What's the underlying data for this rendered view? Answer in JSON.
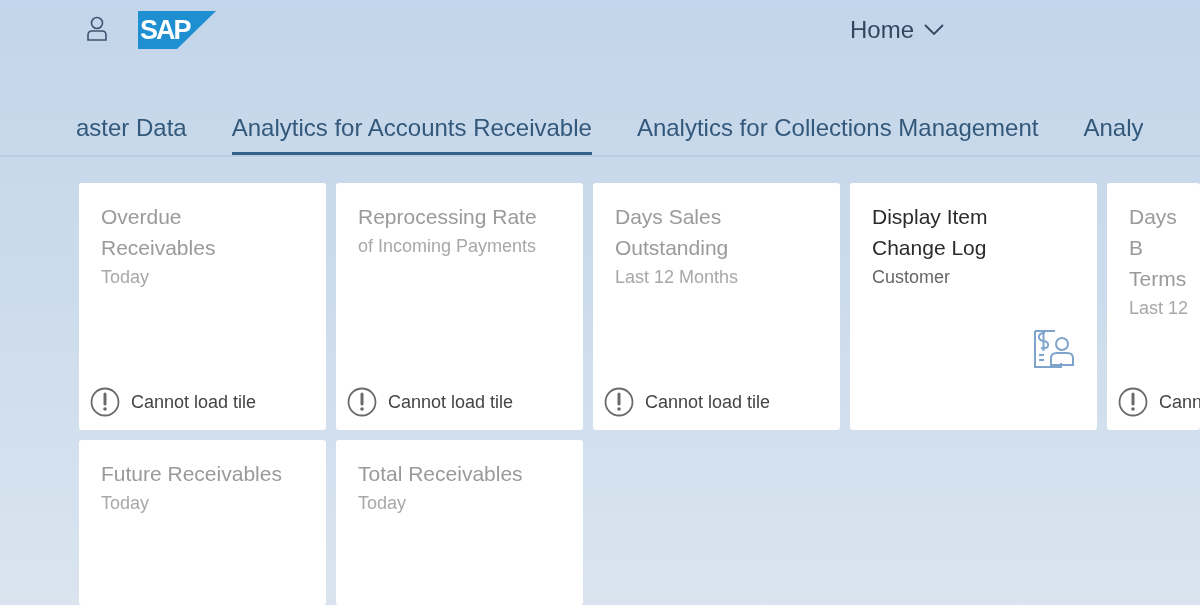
{
  "header": {
    "logo": "SAP",
    "title": "Home"
  },
  "tabs": [
    {
      "label": "aster Data",
      "selected": false
    },
    {
      "label": "Analytics for Accounts Receivable",
      "selected": true
    },
    {
      "label": "Analytics for Collections Management",
      "selected": false
    },
    {
      "label": "Analy",
      "selected": false
    }
  ],
  "tiles": [
    {
      "title": "Overdue Receivables",
      "subtitle": "Today",
      "kind": "error",
      "footer": "Cannot load tile"
    },
    {
      "title": "Reprocessing Rate",
      "subtitle": "of Incoming Payments",
      "kind": "error",
      "footer": "Cannot load tile"
    },
    {
      "title": "Days Sales Outstanding",
      "subtitle": "Last 12 Months",
      "kind": "error",
      "footer": "Cannot load tile"
    },
    {
      "title": "Display Item Change Log",
      "subtitle": "Customer",
      "kind": "app"
    },
    {
      "title": "Days B Terms",
      "subtitle": "Last 12",
      "kind": "error",
      "footer": "Cann"
    },
    {
      "title": "Future Receivables",
      "subtitle": "Today",
      "kind": "loading"
    },
    {
      "title": "Total Receivables",
      "subtitle": "Today",
      "kind": "loading"
    }
  ]
}
